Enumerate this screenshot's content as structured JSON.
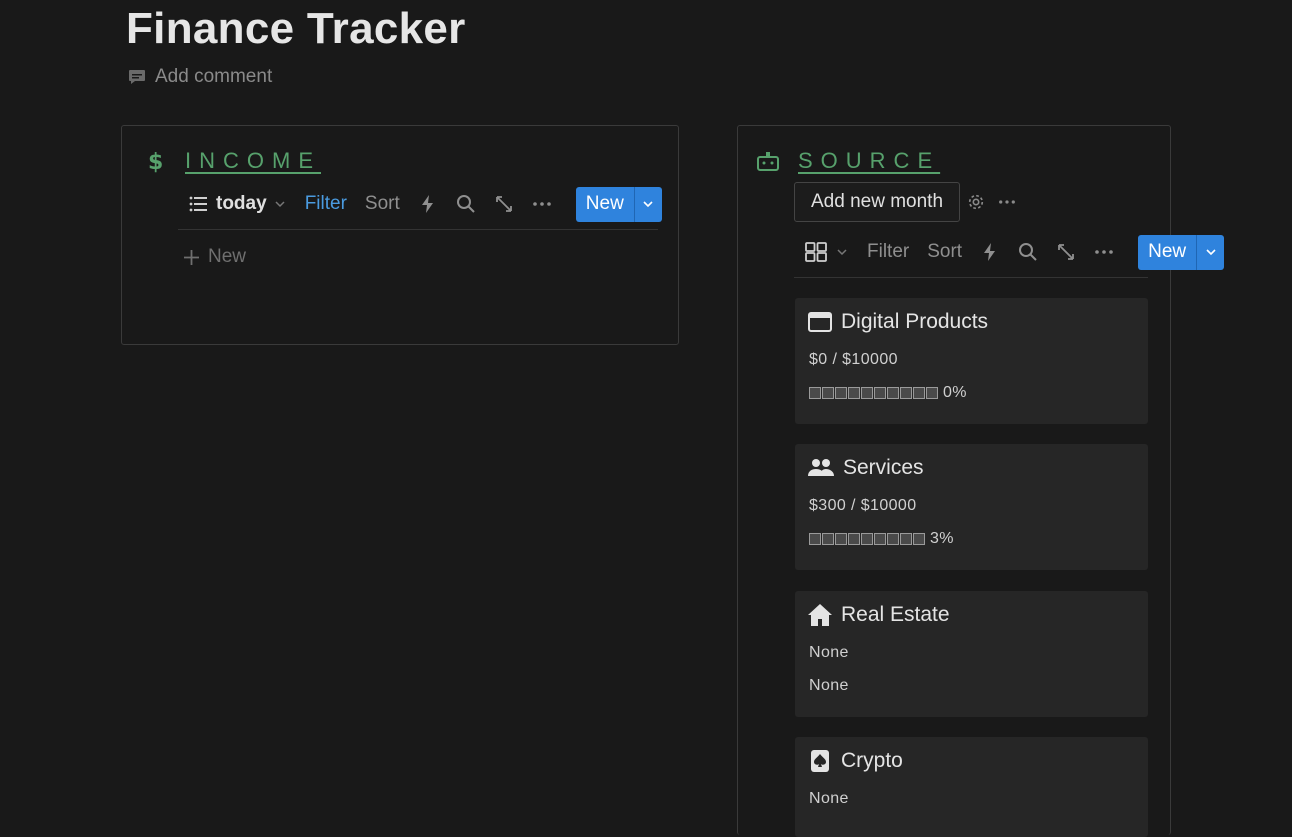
{
  "page": {
    "title": "Finance Tracker",
    "add_comment": "Add comment"
  },
  "income": {
    "heading": "INCOME",
    "view_name": "today",
    "filter": "Filter",
    "sort": "Sort",
    "new_button": "New",
    "add_new": "New"
  },
  "source": {
    "heading": "SOURCE",
    "add_month": "Add new month",
    "filter": "Filter",
    "sort": "Sort",
    "new_button": "New",
    "cards": [
      {
        "title": "Digital Products",
        "icon": "browser-window-icon",
        "amount": "$0 / $10000",
        "percent": "0%",
        "progress": 0
      },
      {
        "title": "Services",
        "icon": "people-icon",
        "amount": "$300 / $10000",
        "percent": "3%",
        "progress": 3
      },
      {
        "title": "Real Estate",
        "icon": "house-icon",
        "amount": "None",
        "percent_line": "None"
      },
      {
        "title": "Crypto",
        "icon": "spade-card-icon",
        "amount": "None"
      }
    ]
  },
  "colors": {
    "background": "#191919",
    "accent_green": "#57a16c",
    "primary_blue": "#2f83dd",
    "filter_blue": "#4a9be0",
    "card_bg": "#262626"
  }
}
